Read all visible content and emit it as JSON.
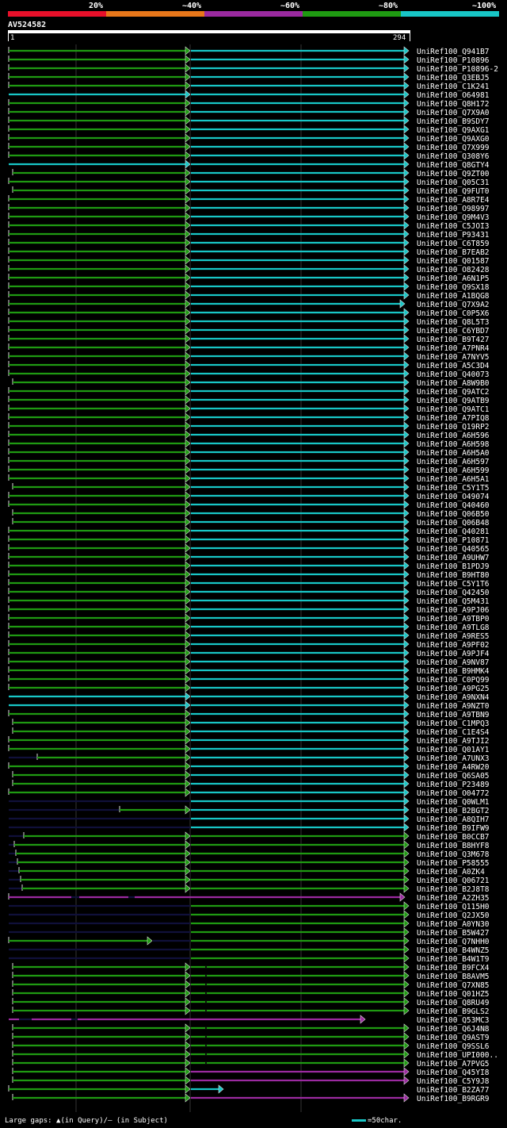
{
  "legend": {
    "labels": [
      "20%",
      "~40%",
      "~60%",
      "~80%",
      "~100%"
    ],
    "colors": [
      "#e8102a",
      "#e8771a",
      "#9b2aa0",
      "#1f9a12",
      "#18c6c6"
    ]
  },
  "query": {
    "name": "AV524582",
    "start": "1",
    "end": "294"
  },
  "footer": {
    "gaps_prefix": "Large gaps: ",
    "gaps_query_symbol": "▲",
    "gaps_query_text": "(in Query)/",
    "gaps_subject_symbol": "—",
    "gaps_subject_text": " (in Subject)",
    "scale_label": "=50char."
  },
  "colors": {
    "green": "#1f9a12",
    "cyan": "#18c6c6",
    "purple": "#9b2aa0",
    "gap": "#10103a",
    "grid": "#333"
  },
  "hits": [
    {
      "name": "UniRef100_Q941B7",
      "type": "A"
    },
    {
      "name": "UniRef100_P10896",
      "type": "A"
    },
    {
      "name": "UniRef100_P10896-2",
      "type": "A"
    },
    {
      "name": "UniRef100_Q3EBJ5",
      "type": "A"
    },
    {
      "name": "UniRef100_C1K241",
      "type": "A"
    },
    {
      "name": "UniRef100_O64981",
      "type": "E"
    },
    {
      "name": "UniRef100_Q8H172",
      "type": "A"
    },
    {
      "name": "UniRef100_Q7X9A0",
      "type": "A"
    },
    {
      "name": "UniRef100_B9SDY7",
      "type": "A"
    },
    {
      "name": "UniRef100_Q9AXG1",
      "type": "A"
    },
    {
      "name": "UniRef100_Q9AXG0",
      "type": "A"
    },
    {
      "name": "UniRef100_Q7X999",
      "type": "A"
    },
    {
      "name": "UniRef100_Q308Y6",
      "type": "A"
    },
    {
      "name": "UniRef100_Q8GTY4",
      "type": "E"
    },
    {
      "name": "UniRef100_Q9ZT00",
      "type": "B"
    },
    {
      "name": "UniRef100_Q05C31",
      "type": "A"
    },
    {
      "name": "UniRef100_Q9FUT0",
      "type": "B"
    },
    {
      "name": "UniRef100_A8R7E4",
      "type": "A"
    },
    {
      "name": "UniRef100_O98997",
      "type": "A"
    },
    {
      "name": "UniRef100_Q9M4V3",
      "type": "A"
    },
    {
      "name": "UniRef100_C5JOI3",
      "type": "A"
    },
    {
      "name": "UniRef100_P93431",
      "type": "A"
    },
    {
      "name": "UniRef100_C6T859",
      "type": "A"
    },
    {
      "name": "UniRef100_B7EAB2",
      "type": "A"
    },
    {
      "name": "UniRef100_Q01587",
      "type": "A"
    },
    {
      "name": "UniRef100_O82428",
      "type": "A"
    },
    {
      "name": "UniRef100_A6N1P5",
      "type": "A"
    },
    {
      "name": "UniRef100_Q9SX18",
      "type": "A"
    },
    {
      "name": "UniRef100_A1BQG8",
      "type": "A"
    },
    {
      "name": "UniRef100_Q7X9A2",
      "type": "F"
    },
    {
      "name": "UniRef100_C0P5X6",
      "type": "A"
    },
    {
      "name": "UniRef100_Q8L5T3",
      "type": "A"
    },
    {
      "name": "UniRef100_C6YBD7",
      "type": "A"
    },
    {
      "name": "UniRef100_B9T427",
      "type": "A"
    },
    {
      "name": "UniRef100_A7PNR4",
      "type": "A"
    },
    {
      "name": "UniRef100_A7NYV5",
      "type": "A"
    },
    {
      "name": "UniRef100_A5C3D4",
      "type": "A"
    },
    {
      "name": "UniRef100_Q40073",
      "type": "A"
    },
    {
      "name": "UniRef100_A8W9B0",
      "type": "B"
    },
    {
      "name": "UniRef100_Q9ATC2",
      "type": "A"
    },
    {
      "name": "UniRef100_Q9ATB9",
      "type": "A"
    },
    {
      "name": "UniRef100_Q9ATC1",
      "type": "A"
    },
    {
      "name": "UniRef100_A7PIQ8",
      "type": "A"
    },
    {
      "name": "UniRef100_Q19RP2",
      "type": "A"
    },
    {
      "name": "UniRef100_A6H596",
      "type": "A"
    },
    {
      "name": "UniRef100_A6H598",
      "type": "A"
    },
    {
      "name": "UniRef100_A6H5A0",
      "type": "A"
    },
    {
      "name": "UniRef100_A6H597",
      "type": "A"
    },
    {
      "name": "UniRef100_A6H599",
      "type": "A"
    },
    {
      "name": "UniRef100_A6H5A1",
      "type": "A"
    },
    {
      "name": "UniRef100_C5Y1T5",
      "type": "B"
    },
    {
      "name": "UniRef100_O49074",
      "type": "A"
    },
    {
      "name": "UniRef100_Q40460",
      "type": "A"
    },
    {
      "name": "UniRef100_Q06B50",
      "type": "B"
    },
    {
      "name": "UniRef100_Q06B48",
      "type": "B"
    },
    {
      "name": "UniRef100_Q40281",
      "type": "A"
    },
    {
      "name": "UniRef100_P10871",
      "type": "A"
    },
    {
      "name": "UniRef100_Q40565",
      "type": "A"
    },
    {
      "name": "UniRef100_A9UHW7",
      "type": "A"
    },
    {
      "name": "UniRef100_B1PDJ9",
      "type": "A"
    },
    {
      "name": "UniRef100_B9HT80",
      "type": "A"
    },
    {
      "name": "UniRef100_C5Y1T6",
      "type": "A"
    },
    {
      "name": "UniRef100_Q42450",
      "type": "A"
    },
    {
      "name": "UniRef100_Q5M431",
      "type": "A"
    },
    {
      "name": "UniRef100_A9PJ06",
      "type": "A"
    },
    {
      "name": "UniRef100_A9TBP0",
      "type": "A"
    },
    {
      "name": "UniRef100_A9TLG8",
      "type": "A"
    },
    {
      "name": "UniRef100_A9RES5",
      "type": "A"
    },
    {
      "name": "UniRef100_A9PF02",
      "type": "A"
    },
    {
      "name": "UniRef100_A9PJF4",
      "type": "A"
    },
    {
      "name": "UniRef100_A9NV87",
      "type": "A"
    },
    {
      "name": "UniRef100_B9HMK4",
      "type": "A"
    },
    {
      "name": "UniRef100_C0PQ99",
      "type": "A"
    },
    {
      "name": "UniRef100_A9PG25",
      "type": "A"
    },
    {
      "name": "UniRef100_A9NXN4",
      "type": "E"
    },
    {
      "name": "UniRef100_A9NZT0",
      "type": "E"
    },
    {
      "name": "UniRef100_A9TBN9",
      "type": "A"
    },
    {
      "name": "UniRef100_C1MPQ3",
      "type": "B"
    },
    {
      "name": "UniRef100_C1E4S4",
      "type": "B"
    },
    {
      "name": "UniRef100_A9TJI2",
      "type": "A"
    },
    {
      "name": "UniRef100_Q01AY1",
      "type": "A"
    },
    {
      "name": "UniRef100_A7UNX3",
      "type": "C"
    },
    {
      "name": "UniRef100_A4RW20",
      "type": "A"
    },
    {
      "name": "UniRef100_Q6SA05",
      "type": "B"
    },
    {
      "name": "UniRef100_P23489",
      "type": "B"
    },
    {
      "name": "UniRef100_O04772",
      "type": "A"
    },
    {
      "name": "UniRef100_Q0WLM1",
      "type": "D"
    },
    {
      "name": "UniRef100_B2BGT2",
      "type": "G"
    },
    {
      "name": "UniRef100_A8QIH7",
      "type": "D"
    },
    {
      "name": "UniRef100_B9IFW9",
      "type": "D"
    },
    {
      "name": "UniRef100_B0CCB7",
      "type": "H"
    },
    {
      "name": "UniRef100_B8HYF8",
      "type": "H"
    },
    {
      "name": "UniRef100_Q3M678",
      "type": "H"
    },
    {
      "name": "UniRef100_P58555",
      "type": "H"
    },
    {
      "name": "UniRef100_A0ZK4",
      "type": "H"
    },
    {
      "name": "UniRef100_Q06721",
      "type": "H"
    },
    {
      "name": "UniRef100_B2J8T8",
      "type": "H"
    },
    {
      "name": "UniRef100_A2ZH35",
      "type": "P"
    },
    {
      "name": "UniRef100_Q115H0",
      "type": "I"
    },
    {
      "name": "UniRef100_Q2JX50",
      "type": "I"
    },
    {
      "name": "UniRef100_A0YN30",
      "type": "I"
    },
    {
      "name": "UniRef100_B5W427",
      "type": "I"
    },
    {
      "name": "UniRef100_Q7NHH0",
      "type": "J"
    },
    {
      "name": "UniRef100_B4WNZ5",
      "type": "I"
    },
    {
      "name": "UniRef100_B4W1T9",
      "type": "I"
    },
    {
      "name": "UniRef100_B9FCX4",
      "type": "K"
    },
    {
      "name": "UniRef100_B8AVM5",
      "type": "K"
    },
    {
      "name": "UniRef100_Q7XN85",
      "type": "K"
    },
    {
      "name": "UniRef100_Q01HZ5",
      "type": "K"
    },
    {
      "name": "UniRef100_Q8RU49",
      "type": "K"
    },
    {
      "name": "UniRef100_B9GLS2",
      "type": "K"
    },
    {
      "name": "UniRef100_Q53MC3",
      "type": "L"
    },
    {
      "name": "UniRef100_Q6J4N8",
      "type": "K"
    },
    {
      "name": "UniRef100_Q9AST9",
      "type": "K"
    },
    {
      "name": "UniRef100_Q9SSL6",
      "type": "K"
    },
    {
      "name": "UniRef100_UPI000..",
      "type": "K"
    },
    {
      "name": "UniRef100_A7PVG5",
      "type": "K"
    },
    {
      "name": "UniRef100_Q45YI8",
      "type": "M"
    },
    {
      "name": "UniRef100_C5Y9J8",
      "type": "M"
    },
    {
      "name": "UniRef100_B2ZA77",
      "type": "N"
    },
    {
      "name": "UniRef100_B9RGR9",
      "type": "O"
    }
  ]
}
